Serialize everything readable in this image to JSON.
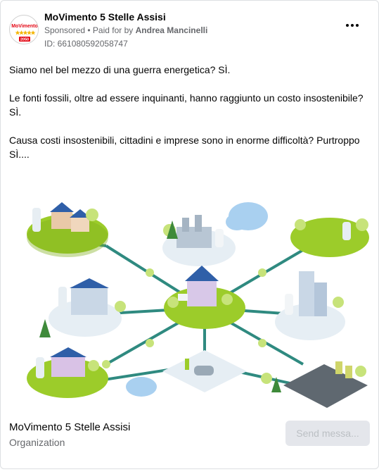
{
  "ad": {
    "page_name": "MoVimento 5 Stelle Assisi",
    "sponsored_label": "Sponsored",
    "paid_for_prefix": " • Paid for by ",
    "payer": "Andrea Mancinelli",
    "id_label": "ID: 661080592058747",
    "avatar_text_top": "MoVimento",
    "avatar_text_bottom": "2050",
    "more_icon": "ellipsis-icon"
  },
  "body": {
    "paragraphs": [
      "Siamo nel bel mezzo di una guerra energetica? SÌ.",
      "Le fonti fossili, oltre ad essere inquinanti, hanno raggiunto un costo insostenibile? SÌ.",
      "Causa costi insostenibili, cittadini e imprese sono in enorme difficoltà? Purtroppo SÌ...."
    ]
  },
  "footer": {
    "title": "MoVimento 5 Stelle Assisi",
    "subtitle": "Organization",
    "cta_label": "Send messa..."
  },
  "colors": {
    "grass": "#9ccc2a",
    "road": "#2f8a80",
    "solar": "#2f5fa8",
    "secondary_text": "#65676b"
  }
}
